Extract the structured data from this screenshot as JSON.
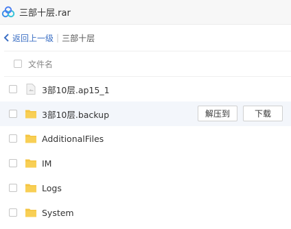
{
  "titlebar": {
    "title": "三部十层.rar",
    "logo_icon": "baidu-netdisk-logo"
  },
  "nav": {
    "back_label": "返回上一级",
    "separator": "|",
    "current": "三部十层"
  },
  "list": {
    "header": {
      "name_label": "文件名"
    },
    "items": [
      {
        "name": "3部10层.ap15_1",
        "icon": "generic-file-icon",
        "highlight": false
      },
      {
        "name": "3部10层.backup",
        "icon": "folder-icon",
        "highlight": true
      },
      {
        "name": "AdditionalFiles",
        "icon": "folder-icon",
        "highlight": false
      },
      {
        "name": "IM",
        "icon": "folder-icon",
        "highlight": false
      },
      {
        "name": "Logs",
        "icon": "folder-icon",
        "highlight": false
      },
      {
        "name": "System",
        "icon": "folder-icon",
        "highlight": false
      }
    ]
  },
  "row_actions": {
    "extract_label": "解压到",
    "download_label": "下载"
  },
  "colors": {
    "link": "#3b6fc4",
    "folder": "#f5c542",
    "highlight_row": "#f3f6fb"
  }
}
